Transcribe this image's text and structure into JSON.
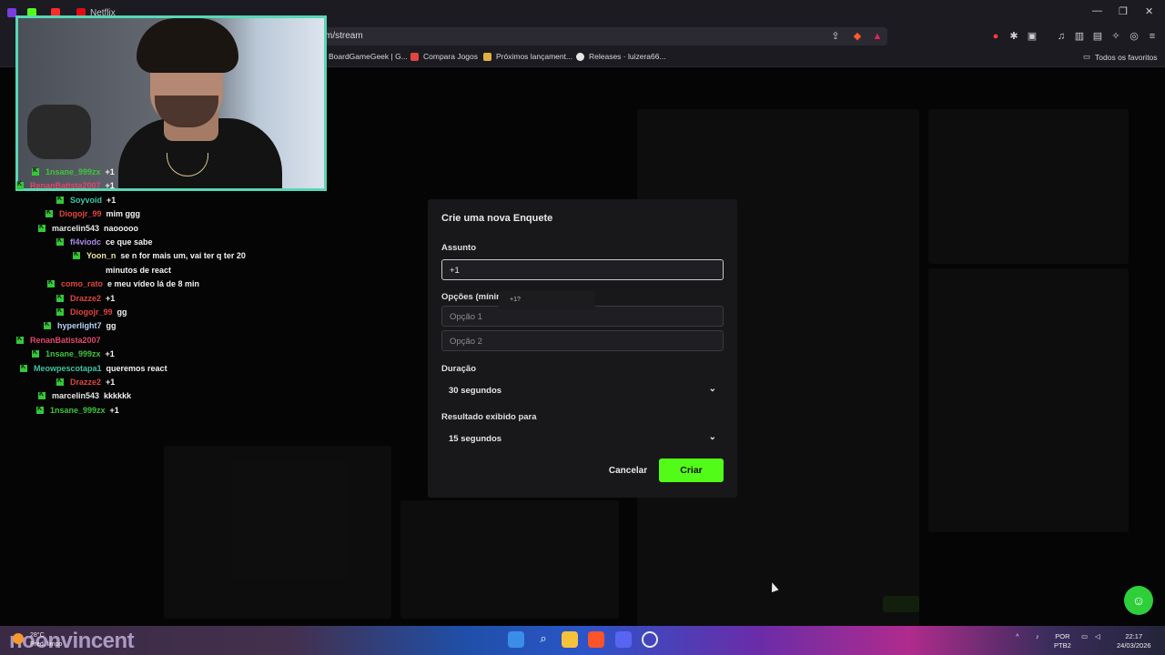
{
  "browser": {
    "tabs": [
      {
        "label": "Netflix"
      }
    ],
    "url": "m/stream",
    "bookmarks": [
      {
        "label": "BoardGameGeek | G..."
      },
      {
        "label": "Compara Jogos"
      },
      {
        "label": "Próximos lançament..."
      },
      {
        "label": "Releases · luizera66..."
      }
    ],
    "favorites_label": "Todos os favoritos"
  },
  "chat": [
    {
      "user": "1nsane_999zx",
      "msg": "+1",
      "color": "#3ec43c"
    },
    {
      "user": "RenanBatista2007",
      "msg": "+1",
      "color": "#e0486a"
    },
    {
      "user": "Soyvoid",
      "msg": "+1",
      "color": "#37c9a6"
    },
    {
      "user": "Diogojr_99",
      "msg": "mim ggg",
      "color": "#e0453f"
    },
    {
      "user": "marcelin543",
      "msg": "naooooo",
      "color": "#e6e6e6"
    },
    {
      "user": "fl4viodc",
      "msg": "ce que sabe",
      "color": "#a88be8"
    },
    {
      "user": "Yoon_n",
      "msg": "se n for mais um, vai ter q ter 20",
      "color": "#ece3a0"
    },
    {
      "user": "",
      "msg": "minutos de react",
      "color": "#ffffff"
    },
    {
      "user": "como_rato",
      "msg": "e meu vídeo lá de 8 min",
      "color": "#e0453f"
    },
    {
      "user": "Drazze2",
      "msg": "+1",
      "color": "#e0453f"
    },
    {
      "user": "Diogojr_99",
      "msg": "gg",
      "color": "#e0453f"
    },
    {
      "user": "hyperlight7",
      "msg": "gg",
      "color": "#b6d0f5"
    },
    {
      "user": "RenanBatista2007",
      "msg": "",
      "color": "#e0486a"
    },
    {
      "user": "1nsane_999zx",
      "msg": "+1",
      "color": "#3ec43c"
    },
    {
      "user": "Meowpescotapa1",
      "msg": "queremos react",
      "color": "#3ec4a0"
    },
    {
      "user": "Drazze2",
      "msg": "+1",
      "color": "#e0453f"
    },
    {
      "user": "marcelin543",
      "msg": "kkkkkk",
      "color": "#e6e6e6"
    },
    {
      "user": "1nsane_999zx",
      "msg": "+1",
      "color": "#3ec43c"
    }
  ],
  "poll_modal": {
    "title": "Crie uma nova Enquete",
    "subject_label": "Assunto",
    "subject_value": "+1",
    "options_label": "Opções (mínim",
    "tooltip": "+1?",
    "option1_placeholder": "Opção 1",
    "option2_placeholder": "Opção 2",
    "duration_label": "Duração",
    "duration_value": "30 segundos",
    "result_label": "Resultado exibido para",
    "result_value": "15 segundos",
    "cancel_label": "Cancelar",
    "create_label": "Criar",
    "accent_color": "#53fc18"
  },
  "taskbar": {
    "logo_text": "noonvincent",
    "weather_temp": "28°C",
    "weather_desc": "Pred. limpo",
    "lang_top": "POR",
    "lang_bottom": "PTB2",
    "time": "22:17",
    "date": "24/03/2026"
  }
}
